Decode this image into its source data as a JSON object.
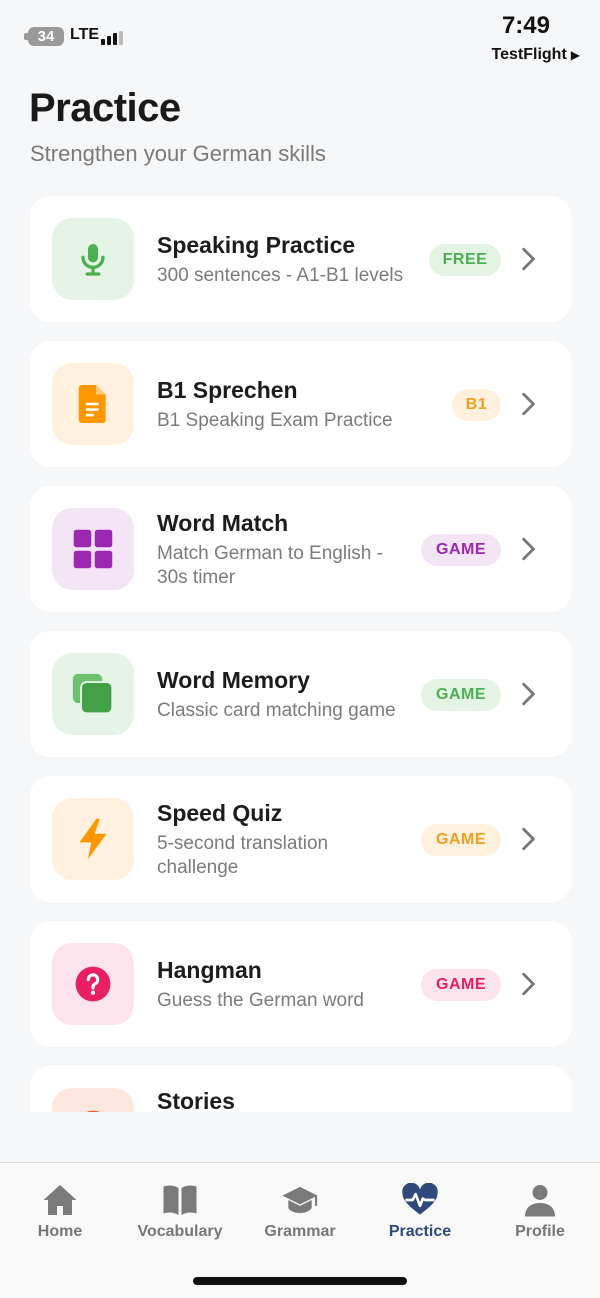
{
  "status_bar": {
    "battery": "34",
    "network": "LTE",
    "time": "7:49",
    "back_app": "TestFlight",
    "back_arrow": "▶"
  },
  "header": {
    "title": "Practice",
    "subtitle": "Strengthen your German skills"
  },
  "items": [
    {
      "title": "Speaking Practice",
      "desc1": "300 sentences - A1-B1 levels",
      "desc2": "",
      "badge": "FREE",
      "icon": "microphone-icon",
      "tile_bg": "#e6f4e7",
      "icon_color": "#4caf50",
      "badge_bg": "#e3f4e4",
      "badge_fg": "#4caf50"
    },
    {
      "title": "B1 Sprechen",
      "desc1": "B1 Speaking Exam Practice",
      "desc2": "",
      "badge": "B1",
      "icon": "document-icon",
      "tile_bg": "#fff1de",
      "icon_color": "#ff9800",
      "badge_bg": "#fff1de",
      "badge_fg": "#f0a020"
    },
    {
      "title": "Word Match",
      "desc1": "Match German to English -",
      "desc2": "30s timer",
      "badge": "GAME",
      "icon": "grid-icon",
      "tile_bg": "#f3e5f5",
      "icon_color": "#9c27b0",
      "badge_bg": "#f3e5f5",
      "badge_fg": "#9c27b0"
    },
    {
      "title": "Word Memory",
      "desc1": "Classic card matching game",
      "desc2": "",
      "badge": "GAME",
      "icon": "cards-icon",
      "tile_bg": "#e6f4e7",
      "icon_color": "#4caf50",
      "badge_bg": "#e3f4e4",
      "badge_fg": "#4caf50"
    },
    {
      "title": "Speed Quiz",
      "desc1": "5-second translation",
      "desc2": "challenge",
      "badge": "GAME",
      "icon": "lightning-icon",
      "tile_bg": "#fff1de",
      "icon_color": "#ff9800",
      "badge_bg": "#fff1de",
      "badge_fg": "#f0a020"
    },
    {
      "title": "Hangman",
      "desc1": "Guess the German word",
      "desc2": "",
      "badge": "GAME",
      "icon": "question-icon",
      "tile_bg": "#fde4ec",
      "icon_color": "#e91e63",
      "badge_bg": "#fde4ec",
      "badge_fg": "#e91e63"
    },
    {
      "title": "Stories",
      "desc1": "",
      "desc2": "",
      "badge": "",
      "icon": "stories-icon",
      "tile_bg": "#fde8e0",
      "icon_color": "#ff5722",
      "badge_bg": "",
      "badge_fg": ""
    }
  ],
  "tabs": [
    {
      "label": "Home",
      "icon": "home-icon",
      "active": false
    },
    {
      "label": "Vocabulary",
      "icon": "book-icon",
      "active": false
    },
    {
      "label": "Grammar",
      "icon": "graduation-cap-icon",
      "active": false
    },
    {
      "label": "Practice",
      "icon": "heart-pulse-icon",
      "active": true
    },
    {
      "label": "Profile",
      "icon": "person-icon",
      "active": false
    }
  ],
  "colors": {
    "background": "#f6f7f9",
    "active_tab": "#2f4a7a",
    "inactive_tab": "#777777",
    "chevron": "#777777"
  }
}
